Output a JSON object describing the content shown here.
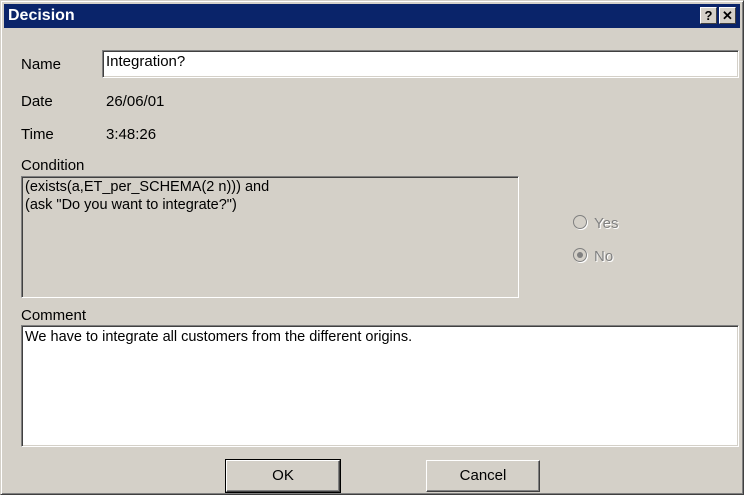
{
  "window": {
    "title": "Decision",
    "help_glyph": "?",
    "close_glyph": "✕"
  },
  "form": {
    "name_label": "Name",
    "name_value": "Integration?",
    "date_label": "Date",
    "date_value": "26/06/01",
    "time_label": "Time",
    "time_value": "3:48:26",
    "condition_label": "Condition",
    "condition_line1": "(exists(a,ET_per_SCHEMA(2 n))) and",
    "condition_line2": "(ask \"Do you want to integrate?\")",
    "comment_label": "Comment",
    "comment_value": "We have to integrate all customers from the different origins."
  },
  "choice": {
    "yes_label": "Yes",
    "no_label": "No",
    "selected": "No",
    "enabled": false
  },
  "buttons": {
    "ok_label": "OK",
    "cancel_label": "Cancel"
  },
  "colors": {
    "titlebar": "#0a246a",
    "face": "#d4d0c8"
  }
}
